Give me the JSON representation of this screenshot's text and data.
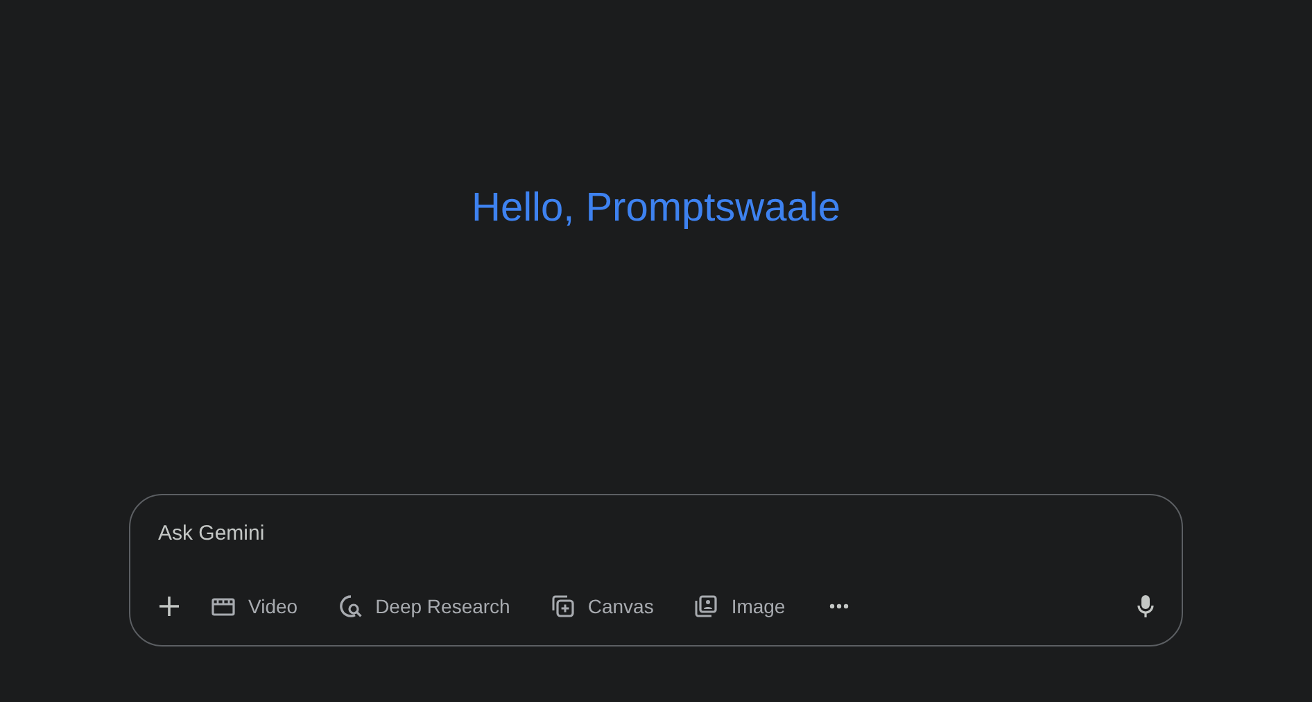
{
  "greeting": "Hello, Promptswaale",
  "prompt": {
    "placeholder": "Ask Gemini"
  },
  "tools": [
    {
      "kind": "video",
      "label": "Video"
    },
    {
      "kind": "research",
      "label": "Deep Research"
    },
    {
      "kind": "canvas",
      "label": "Canvas"
    },
    {
      "kind": "image",
      "label": "Image"
    }
  ]
}
